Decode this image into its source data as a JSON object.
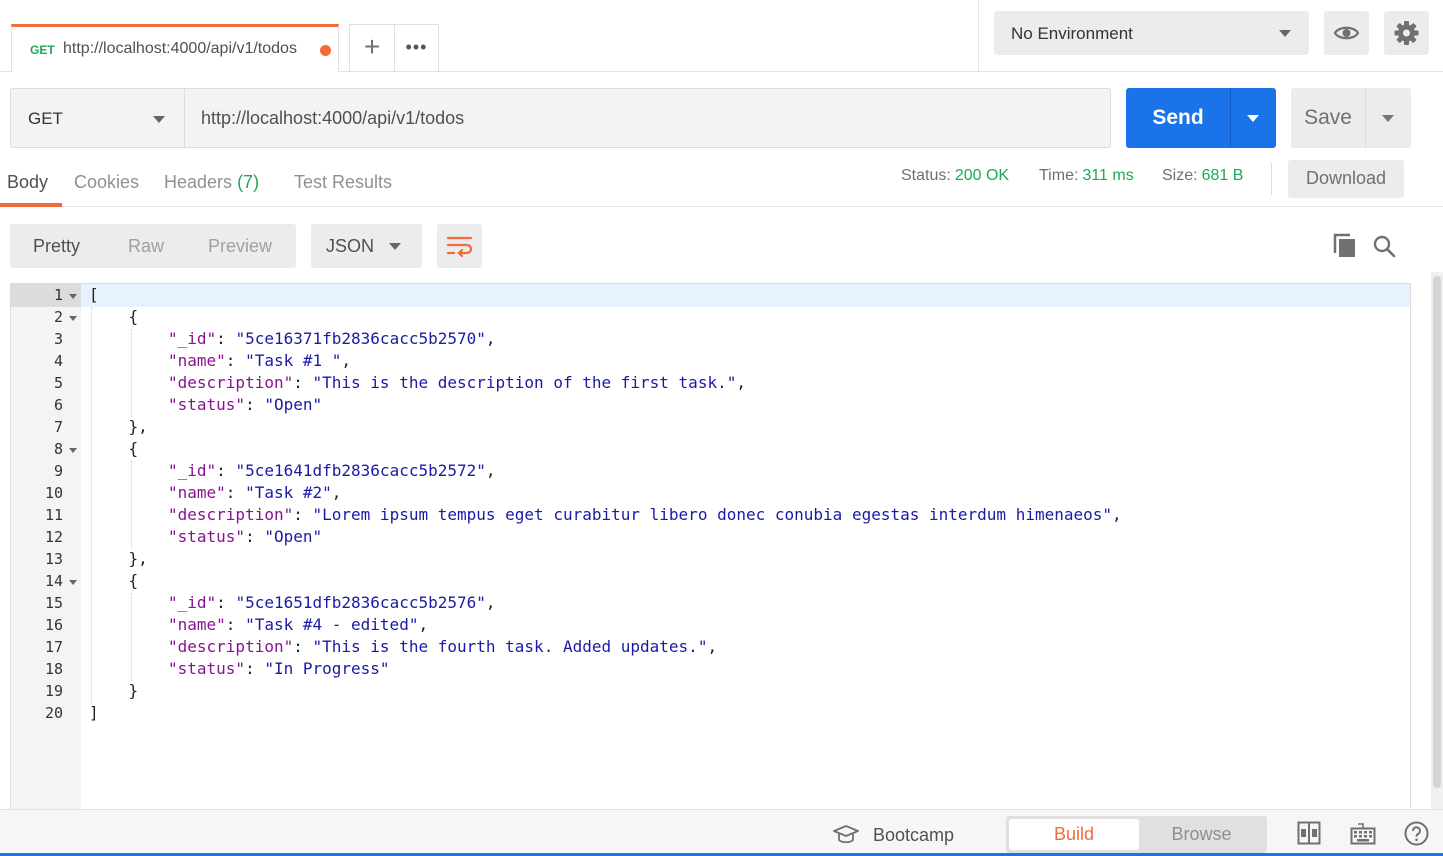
{
  "tabs": {
    "active": {
      "method": "GET",
      "url": "http://localhost:4000/api/v1/todos"
    },
    "add_label": "+",
    "more_label": "•••"
  },
  "environment": {
    "selected": "No Environment"
  },
  "request": {
    "method": "GET",
    "url": "http://localhost:4000/api/v1/todos",
    "send_label": "Send",
    "save_label": "Save"
  },
  "response": {
    "tabs": {
      "body": "Body",
      "cookies": "Cookies",
      "headers": "Headers",
      "headers_count": "(7)",
      "tests": "Test Results"
    },
    "status_label": "Status:",
    "status_value": "200 OK",
    "time_label": "Time:",
    "time_value": "311 ms",
    "size_label": "Size:",
    "size_value": "681 B",
    "download_label": "Download",
    "view_modes": {
      "pretty": "Pretty",
      "raw": "Raw",
      "preview": "Preview"
    },
    "format": "JSON"
  },
  "body_json": [
    {
      "_id": "5ce16371fb2836cacc5b2570",
      "name": "Task #1 ",
      "description": "This is the description of the first task.",
      "status": "Open"
    },
    {
      "_id": "5ce1641dfb2836cacc5b2572",
      "name": "Task #2",
      "description": "Lorem ipsum tempus eget curabitur libero donec conubia egestas interdum himenaeos",
      "status": "Open"
    },
    {
      "_id": "5ce1651dfb2836cacc5b2576",
      "name": "Task #4 - edited",
      "description": "This is the fourth task. Added updates.",
      "status": "In Progress"
    }
  ],
  "footer": {
    "bootcamp": "Bootcamp",
    "build": "Build",
    "browse": "Browse"
  },
  "colors": {
    "accent": "#f26b3a",
    "primary": "#1a73e8",
    "success": "#1aaa55"
  }
}
